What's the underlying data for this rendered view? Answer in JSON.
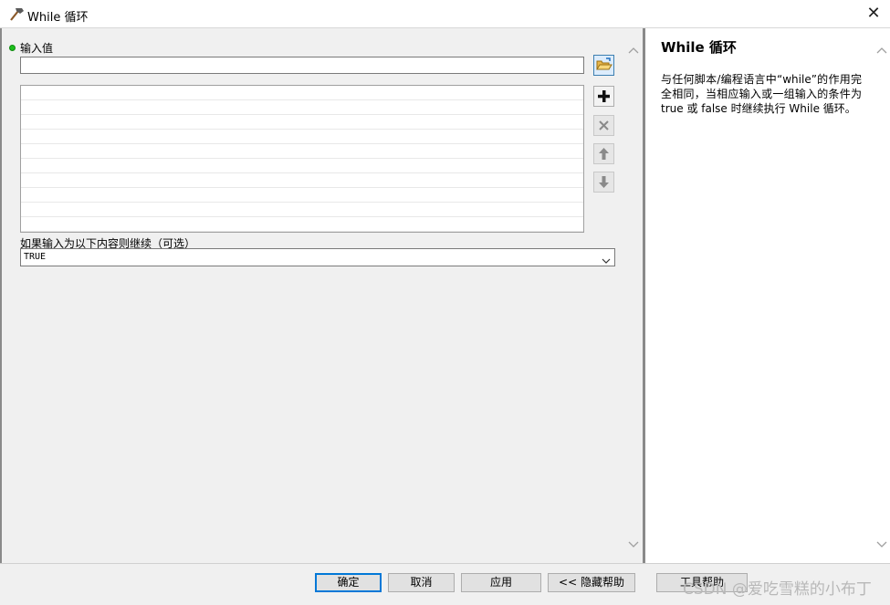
{
  "window": {
    "title": "While 循环",
    "close_label": "✕"
  },
  "form": {
    "input_label": "输入值",
    "input_value": "",
    "list_rows": 10,
    "optional_label": "如果输入为以下内容则继续（可选）",
    "select_value": "TRUE"
  },
  "help": {
    "title": "While 循环",
    "body": "与任何脚本/编程语言中“while”的作用完全相同，当相应输入或一组输入的条件为 true 或 false 时继续执行 While 循环。"
  },
  "buttons": {
    "ok": "确定",
    "cancel": "取消",
    "apply": "应用",
    "hide_help": "<< 隐藏帮助",
    "tool_help": "工具帮助"
  },
  "watermark": "CSDN @爱吃雪糕的小布丁",
  "icons": {
    "title": "hammer-icon",
    "browse": "open-folder-icon",
    "add": "plus-icon",
    "delete": "x-icon",
    "up": "arrow-up-icon",
    "down": "arrow-down-icon"
  },
  "colors": {
    "required_dot": "#1dbf1d",
    "default_button_border": "#0078d7",
    "browse_button_bg": "#dcecfc"
  }
}
